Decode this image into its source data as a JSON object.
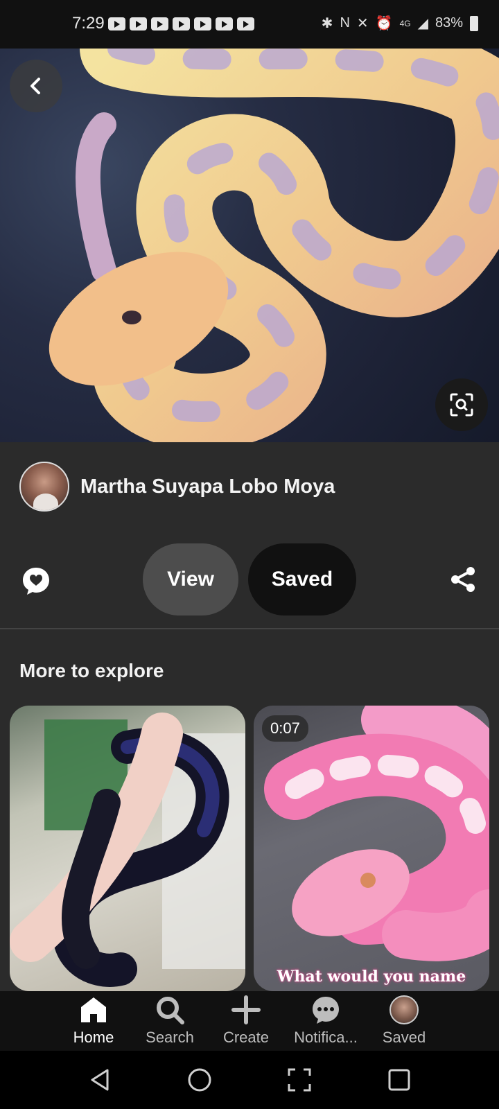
{
  "status_bar": {
    "time": "7:29",
    "battery": "83%",
    "network": "4G"
  },
  "pin": {
    "author_name": "Martha Suyapa Lobo Moya",
    "view_label": "View",
    "saved_label": "Saved"
  },
  "explore": {
    "title": "More to explore",
    "items": [
      {
        "duration": "",
        "caption": ""
      },
      {
        "duration": "0:07",
        "caption": "What would you name"
      }
    ]
  },
  "bottom_nav": {
    "items": [
      {
        "label": "Home",
        "icon": "home-icon",
        "active": true
      },
      {
        "label": "Search",
        "icon": "search-icon"
      },
      {
        "label": "Create",
        "icon": "plus-icon"
      },
      {
        "label": "Notifica...",
        "icon": "chat-bubble-icon"
      },
      {
        "label": "Saved",
        "icon": "avatar"
      }
    ]
  },
  "colors": {
    "background": "#2b2b2b",
    "button_view": "#4d4d4d",
    "button_saved": "#111111",
    "nav_bar": "#111111"
  }
}
